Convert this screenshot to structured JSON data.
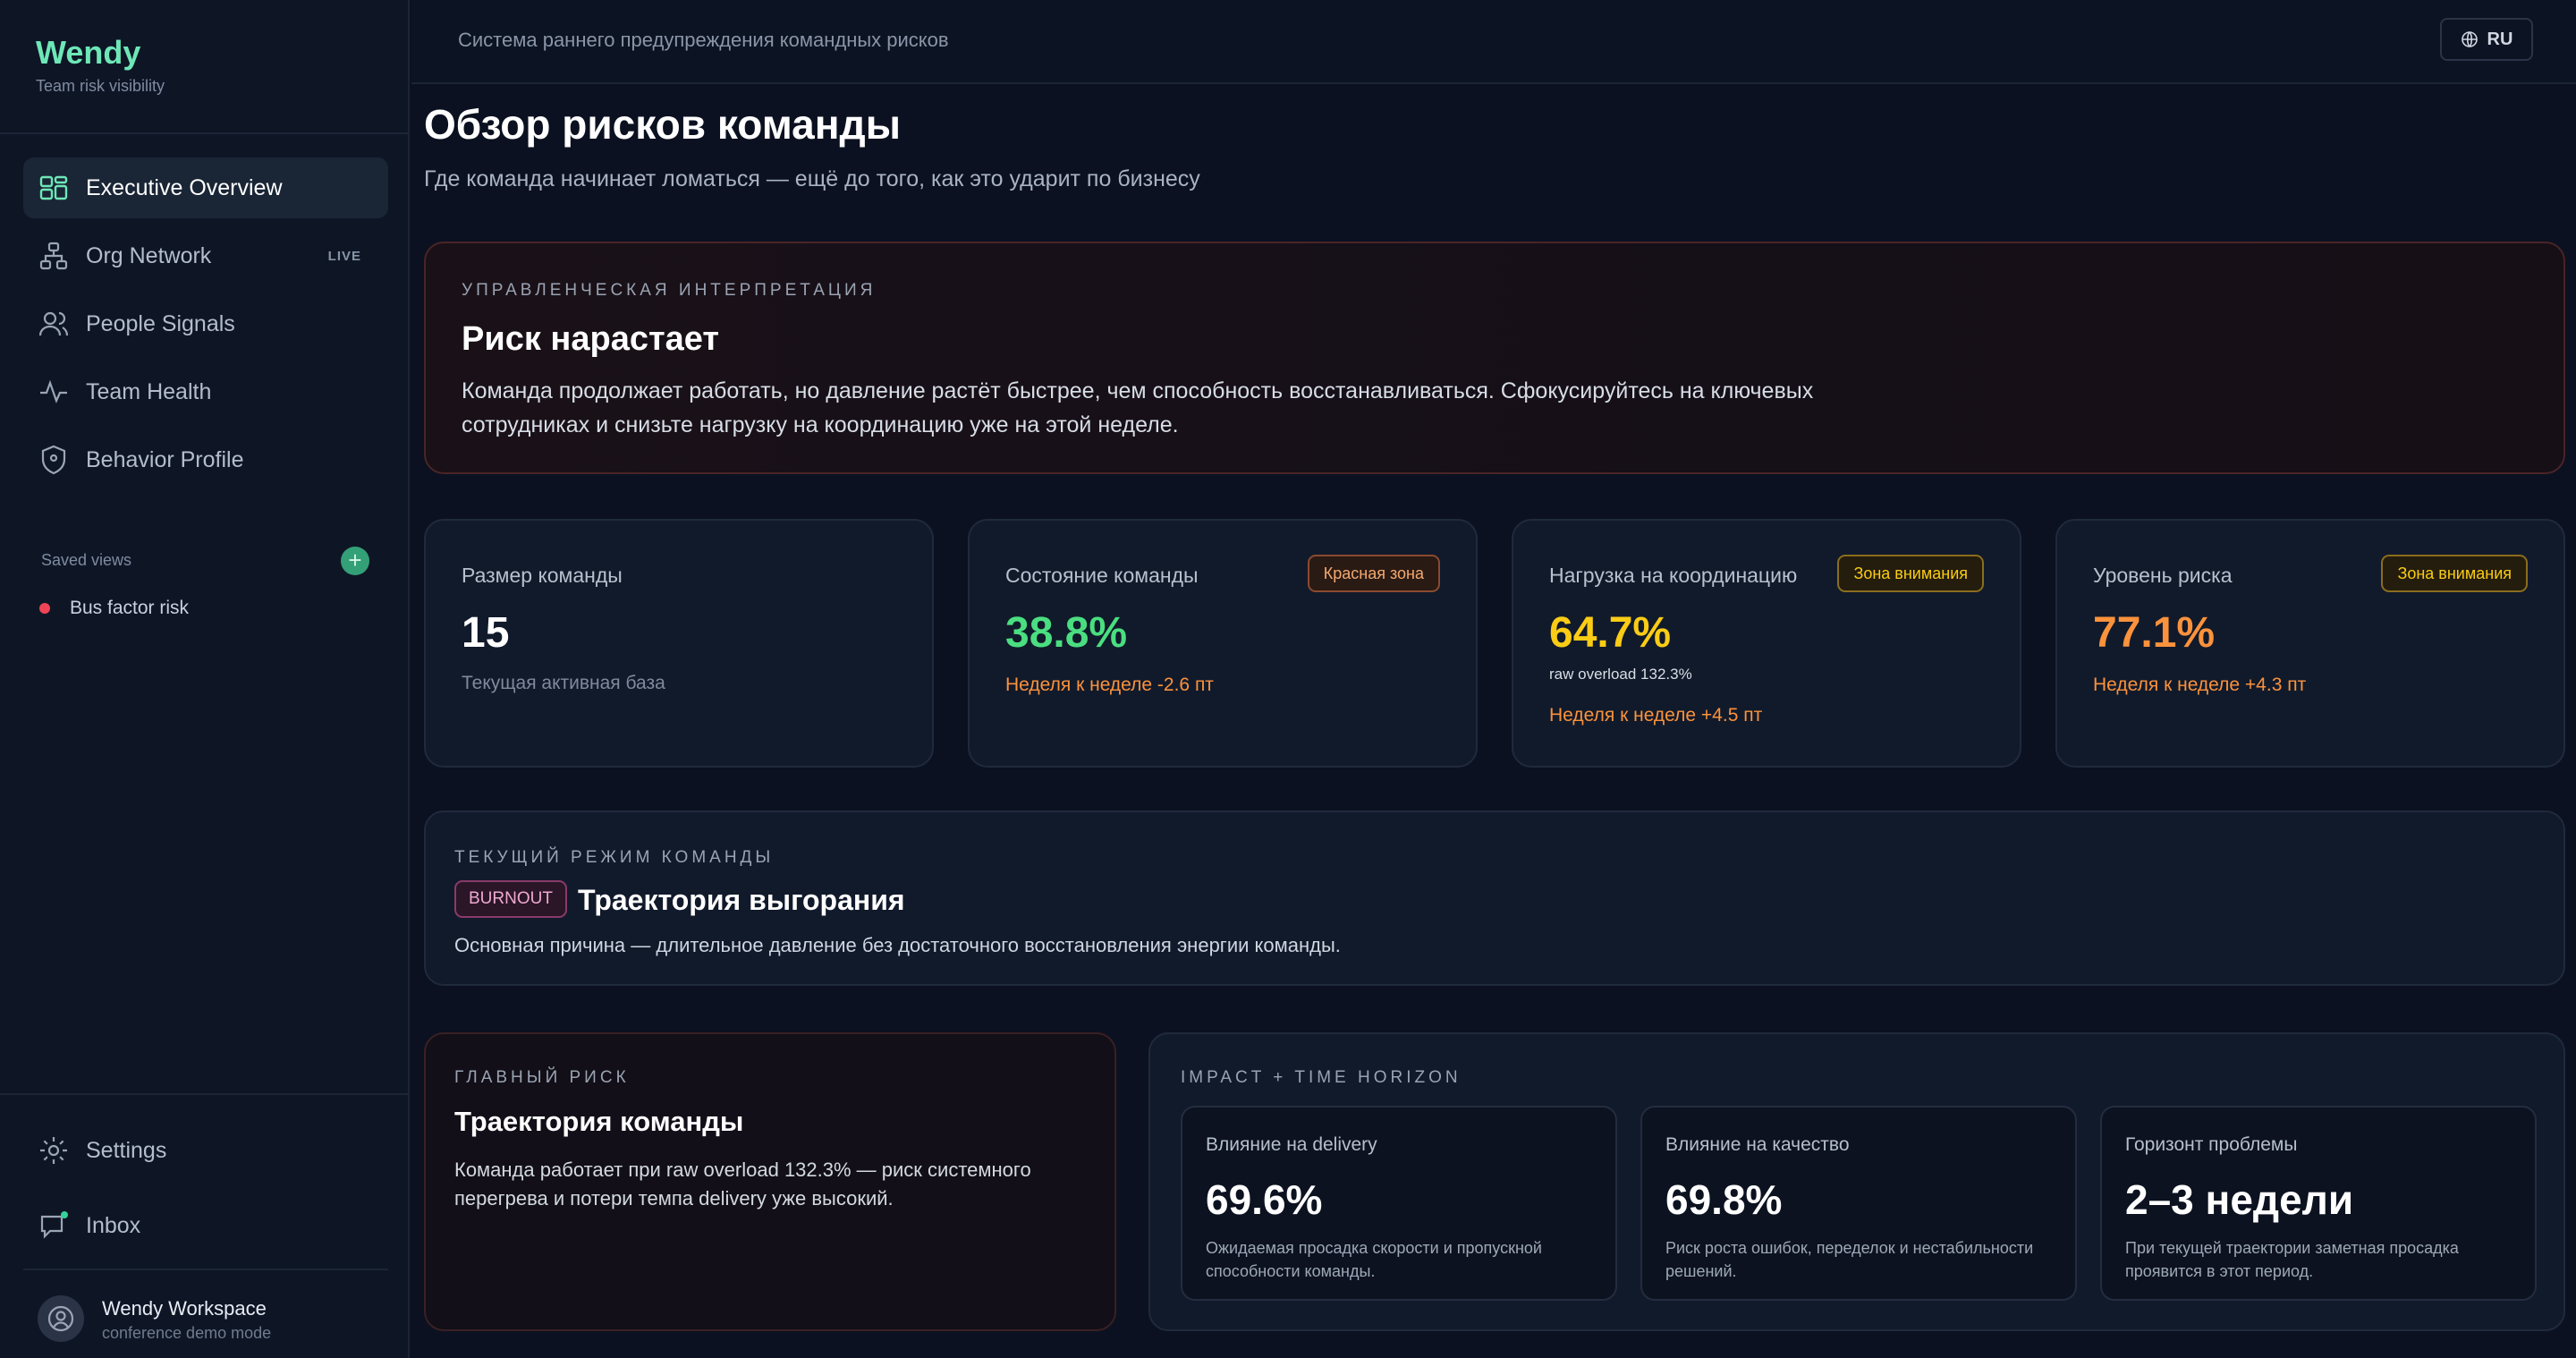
{
  "brand": {
    "name": "Wendy",
    "subtitle": "Team risk visibility"
  },
  "nav": {
    "items": [
      {
        "label": "Executive Overview",
        "icon": "dashboard-icon",
        "active": true
      },
      {
        "label": "Org Network",
        "icon": "network-icon",
        "badge": "LIVE"
      },
      {
        "label": "People Signals",
        "icon": "people-icon"
      },
      {
        "label": "Team Health",
        "icon": "pulse-icon"
      },
      {
        "label": "Behavior Profile",
        "icon": "shield-icon"
      }
    ],
    "saved_views_label": "Saved views",
    "add_symbol": "+",
    "saved_views": [
      {
        "label": "Bus factor risk",
        "color": "#ef4456"
      }
    ],
    "settings": "Settings",
    "inbox": "Inbox"
  },
  "workspace": {
    "name": "Wendy Workspace",
    "mode": "conference demo mode"
  },
  "topbar": {
    "title": "Система раннего предупреждения командных рисков",
    "lang": "RU"
  },
  "page": {
    "title": "Обзор рисков команды",
    "subtitle": "Где команда начинает ломаться — ещё до того, как это ударит по бизнесу"
  },
  "interpretation": {
    "eyebrow": "Управленческая интерпретация",
    "title": "Риск нарастает",
    "text": "Команда продолжает работать, но давление растёт быстрее, чем способность восстанавливаться. Сфокусируйтесь на ключевых сотрудниках и снизьте нагрузку на координацию уже на этой неделе."
  },
  "kpis": [
    {
      "label": "Размер команды",
      "value": "15",
      "note": "Текущая активная база"
    },
    {
      "label": "Состояние команды",
      "value": "38.8%",
      "badge": "Красная зона",
      "note": "Неделя к неделе -2.6 пт",
      "value_color": "#4ade80"
    },
    {
      "label": "Нагрузка на координацию",
      "value": "64.7%",
      "badge": "Зона внимания",
      "extra": "raw overload 132.3%",
      "note": "Неделя к неделе +4.5 пт",
      "value_color": "#facc15"
    },
    {
      "label": "Уровень риска",
      "value": "77.1%",
      "badge": "Зона внимания",
      "note": "Неделя к неделе +4.3 пт",
      "value_color": "#fb923c"
    }
  ],
  "mode": {
    "eyebrow": "Текущий режим команды",
    "tag": "BURNOUT",
    "title": "Траектория выгорания",
    "text": "Основная причина — длительное давление без достаточного восстановления энергии команды."
  },
  "main_risk": {
    "eyebrow": "Главный риск",
    "title": "Траектория команды",
    "text": "Команда работает при raw overload 132.3% — риск системного перегрева и потери темпа delivery уже высокий."
  },
  "impact": {
    "eyebrow": "Impact + time horizon",
    "cards": [
      {
        "label": "Влияние на delivery",
        "value": "69.6%",
        "desc": "Ожидаемая просадка скорости и пропускной способности команды."
      },
      {
        "label": "Влияние на качество",
        "value": "69.8%",
        "desc": "Риск роста ошибок, переделок и нестабильности решений."
      },
      {
        "label": "Горизонт проблемы",
        "value": "2–3 недели",
        "desc": "При текущей траектории заметная просадка проявится в этот период."
      }
    ]
  }
}
